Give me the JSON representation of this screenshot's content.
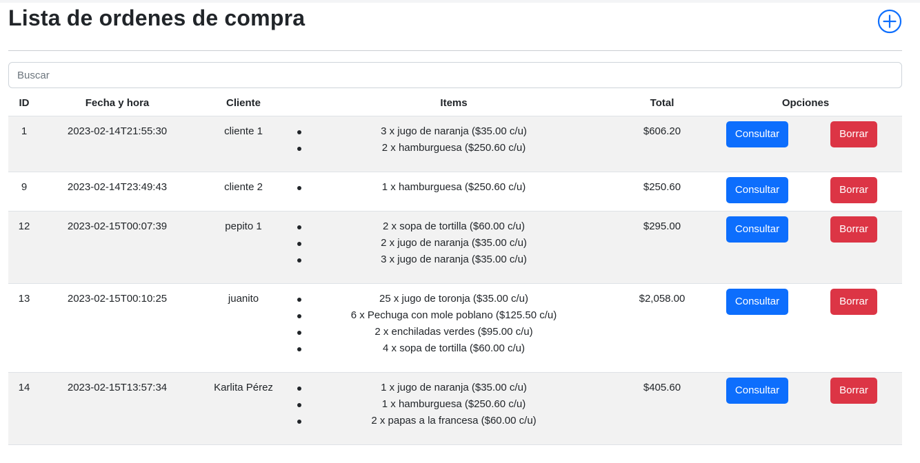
{
  "header": {
    "title": "Lista de ordenes de compra",
    "add_icon": "plus-circle-icon"
  },
  "search": {
    "placeholder": "Buscar",
    "value": ""
  },
  "table": {
    "columns": [
      "ID",
      "Fecha y hora",
      "Cliente",
      "Items",
      "Total",
      "Opciones"
    ],
    "rows": [
      {
        "id": "1",
        "fecha": "2023-02-14T21:55:30",
        "cliente": "cliente 1",
        "items": [
          "3 x jugo de naranja ($35.00 c/u)",
          "2 x hamburguesa ($250.60 c/u)"
        ],
        "total": "$606.20"
      },
      {
        "id": "9",
        "fecha": "2023-02-14T23:49:43",
        "cliente": "cliente 2",
        "items": [
          "1 x hamburguesa ($250.60 c/u)"
        ],
        "total": "$250.60"
      },
      {
        "id": "12",
        "fecha": "2023-02-15T00:07:39",
        "cliente": "pepito 1",
        "items": [
          "2 x sopa de tortilla ($60.00 c/u)",
          "2 x jugo de naranja ($35.00 c/u)",
          "3 x jugo de naranja ($35.00 c/u)"
        ],
        "total": "$295.00"
      },
      {
        "id": "13",
        "fecha": "2023-02-15T00:10:25",
        "cliente": "juanito",
        "items": [
          "25 x jugo de toronja ($35.00 c/u)",
          "6 x Pechuga con mole poblano ($125.50 c/u)",
          "2 x enchiladas verdes ($95.00 c/u)",
          "4 x sopa de tortilla ($60.00 c/u)"
        ],
        "total": "$2,058.00"
      },
      {
        "id": "14",
        "fecha": "2023-02-15T13:57:34",
        "cliente": "Karlita Pérez",
        "items": [
          "1 x jugo de naranja ($35.00 c/u)",
          "1 x hamburguesa ($250.60 c/u)",
          "2 x papas a la francesa ($60.00 c/u)"
        ],
        "total": "$405.60"
      }
    ]
  },
  "actions": {
    "consult_label": "Consultar",
    "delete_label": "Borrar"
  },
  "colors": {
    "primary": "#0d6efd",
    "danger": "#dc3545",
    "stripe": "#f2f2f2"
  }
}
